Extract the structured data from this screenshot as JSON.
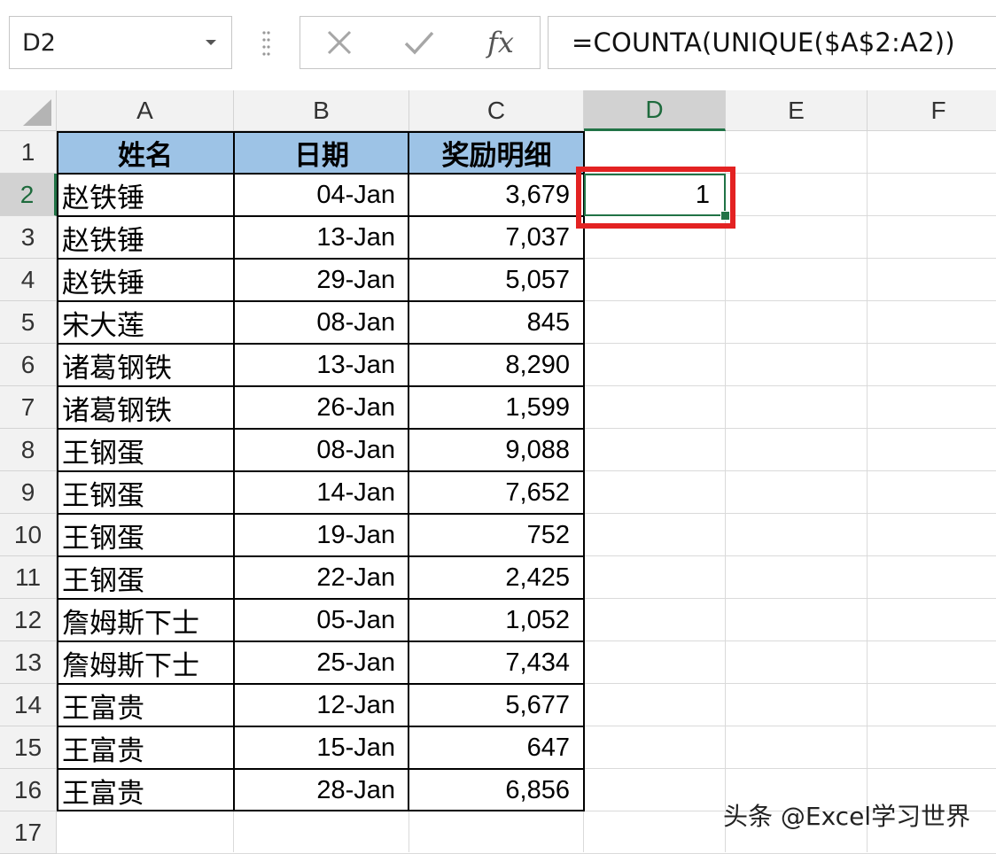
{
  "formula_bar": {
    "name_box": "D2",
    "cancel_symbol": "✕",
    "enter_symbol": "✓",
    "fx_symbol": "fx",
    "formula": "=COUNTA(UNIQUE($A$2:A2))"
  },
  "grid": {
    "columns": [
      "A",
      "B",
      "C",
      "D",
      "E",
      "F"
    ],
    "active_column": "D",
    "active_row": 2,
    "header": {
      "name": "姓名",
      "date": "日期",
      "reward": "奖励明细"
    },
    "rows": [
      {
        "row": "2",
        "name": "赵铁锤",
        "date": "04-Jan",
        "reward": "3,679",
        "d": "1"
      },
      {
        "row": "3",
        "name": "赵铁锤",
        "date": "13-Jan",
        "reward": "7,037"
      },
      {
        "row": "4",
        "name": "赵铁锤",
        "date": "29-Jan",
        "reward": "5,057"
      },
      {
        "row": "5",
        "name": "宋大莲",
        "date": "08-Jan",
        "reward": "845"
      },
      {
        "row": "6",
        "name": "诸葛钢铁",
        "date": "13-Jan",
        "reward": "8,290"
      },
      {
        "row": "7",
        "name": "诸葛钢铁",
        "date": "26-Jan",
        "reward": "1,599"
      },
      {
        "row": "8",
        "name": "王钢蛋",
        "date": "08-Jan",
        "reward": "9,088"
      },
      {
        "row": "9",
        "name": "王钢蛋",
        "date": "14-Jan",
        "reward": "7,652"
      },
      {
        "row": "10",
        "name": "王钢蛋",
        "date": "19-Jan",
        "reward": "752"
      },
      {
        "row": "11",
        "name": "王钢蛋",
        "date": "22-Jan",
        "reward": "2,425"
      },
      {
        "row": "12",
        "name": "詹姆斯下士",
        "date": "05-Jan",
        "reward": "1,052"
      },
      {
        "row": "13",
        "name": "詹姆斯下士",
        "date": "25-Jan",
        "reward": "7,434"
      },
      {
        "row": "14",
        "name": "王富贵",
        "date": "12-Jan",
        "reward": "5,677"
      },
      {
        "row": "15",
        "name": "王富贵",
        "date": "15-Jan",
        "reward": "647"
      },
      {
        "row": "16",
        "name": "王富贵",
        "date": "28-Jan",
        "reward": "6,856"
      }
    ],
    "row_numbers": [
      "1",
      "2",
      "3",
      "4",
      "5",
      "6",
      "7",
      "8",
      "9",
      "10",
      "11",
      "12",
      "13",
      "14",
      "15",
      "16",
      "17"
    ]
  },
  "watermark": "头条 @Excel学习世界",
  "colors": {
    "header_fill": "#9dc3e6",
    "accent": "#217346",
    "highlight": "#e32222"
  }
}
